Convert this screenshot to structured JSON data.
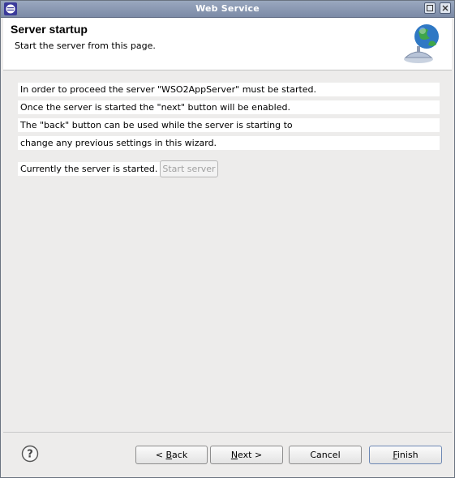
{
  "window": {
    "title": "Web Service"
  },
  "header": {
    "title": "Server startup",
    "description": "Start the server from this page."
  },
  "content": {
    "lines": [
      "In order to proceed the server \"WSO2AppServer\" must be started.",
      "Once the server is started the \"next\" button will be enabled.",
      "The \"back\" button can be used while the server is starting to",
      "change any previous settings in this wizard."
    ],
    "status": "Currently the server is started.",
    "start_button": "Start server"
  },
  "footer": {
    "back": {
      "pre": "< ",
      "mnemonic": "B",
      "post": "ack"
    },
    "next": {
      "pre": "",
      "mnemonic": "N",
      "post": "ext >"
    },
    "cancel": "Cancel",
    "finish": {
      "pre": "",
      "mnemonic": "F",
      "post": "inish"
    }
  },
  "icons": {
    "app": "eclipse-icon",
    "banner": "globe-server-icon",
    "help": "help-icon"
  },
  "colors": {
    "titlebar": "#8494b0",
    "header_bg": "#ffffff",
    "dialog_bg": "#edeceb",
    "disabled_text": "#a0a0a0"
  }
}
